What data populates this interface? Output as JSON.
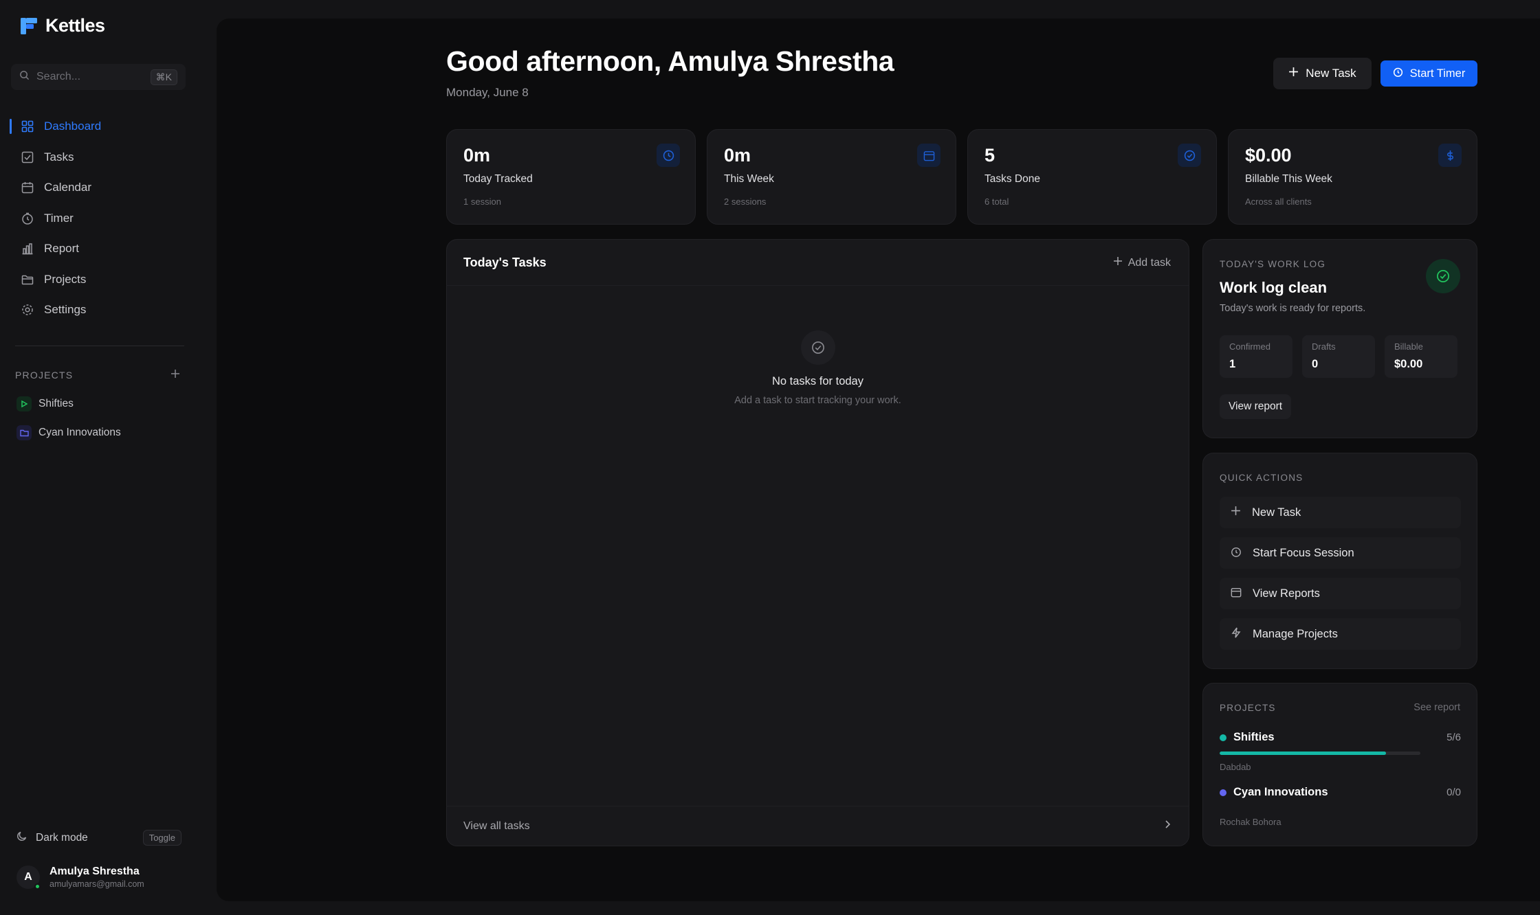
{
  "app": {
    "name": "Kettles"
  },
  "search": {
    "placeholder": "Search...",
    "shortcut": "⌘K"
  },
  "nav": {
    "items": [
      {
        "label": "Dashboard",
        "icon": "grid-icon",
        "active": true
      },
      {
        "label": "Tasks",
        "icon": "check-square-icon"
      },
      {
        "label": "Calendar",
        "icon": "calendar-icon"
      },
      {
        "label": "Timer",
        "icon": "timer-icon"
      },
      {
        "label": "Report",
        "icon": "bar-chart-icon"
      },
      {
        "label": "Projects",
        "icon": "folder-icon"
      },
      {
        "label": "Settings",
        "icon": "gear-icon"
      }
    ]
  },
  "sidebar_projects": {
    "heading": "PROJECTS",
    "items": [
      {
        "label": "Shifties",
        "icon": "play-icon",
        "color": "#22c55e"
      },
      {
        "label": "Cyan Innovations",
        "icon": "folder-icon",
        "color": "#6366f1"
      }
    ]
  },
  "theme": {
    "label": "Dark mode",
    "toggle": "Toggle"
  },
  "user": {
    "initial": "A",
    "name": "Amulya Shrestha",
    "email": "amulyamars@gmail.com"
  },
  "header": {
    "greeting": "Good afternoon, Amulya Shrestha",
    "date": "Monday, June 8",
    "new_task": "New Task",
    "start_timer": "Start Timer"
  },
  "stats": [
    {
      "value": "0m",
      "label": "Today Tracked",
      "sub": "1 session",
      "icon": "clock-icon"
    },
    {
      "value": "0m",
      "label": "This Week",
      "sub": "2 sessions",
      "icon": "calendar-icon"
    },
    {
      "value": "5",
      "label": "Tasks Done",
      "sub": "6 total",
      "icon": "check-circle-icon"
    },
    {
      "value": "$0.00",
      "label": "Billable This Week",
      "sub": "Across all clients",
      "icon": "dollar-icon"
    }
  ],
  "tasks": {
    "title": "Today's Tasks",
    "add": "Add task",
    "empty_title": "No tasks for today",
    "empty_sub": "Add a task to start tracking your work.",
    "view_all": "View all tasks"
  },
  "work_log": {
    "eyebrow": "TODAY'S WORK LOG",
    "title": "Work log clean",
    "sub": "Today's work is ready for reports.",
    "stats": [
      {
        "label": "Confirmed",
        "value": "1"
      },
      {
        "label": "Drafts",
        "value": "0"
      },
      {
        "label": "Billable",
        "value": "$0.00"
      }
    ],
    "button": "View report"
  },
  "quick_actions": {
    "eyebrow": "QUICK ACTIONS",
    "items": [
      {
        "label": "New Task",
        "icon": "plus-icon"
      },
      {
        "label": "Start Focus Session",
        "icon": "timer-icon"
      },
      {
        "label": "View Reports",
        "icon": "calendar-icon"
      },
      {
        "label": "Manage Projects",
        "icon": "lightning-icon"
      }
    ]
  },
  "projects_panel": {
    "eyebrow": "PROJECTS",
    "link": "See report",
    "items": [
      {
        "name": "Shifties",
        "count": "5/6",
        "client": "Dabdab",
        "color": "#14b8a6",
        "progress": 0.83
      },
      {
        "name": "Cyan Innovations",
        "count": "0/0",
        "client": "Rochak Bohora",
        "color": "#6366f1",
        "progress": null
      }
    ]
  },
  "colors": {
    "accent": "#2f7bff",
    "primary_button": "#1160f5",
    "success": "#22c55e",
    "teal": "#14b8a6"
  }
}
